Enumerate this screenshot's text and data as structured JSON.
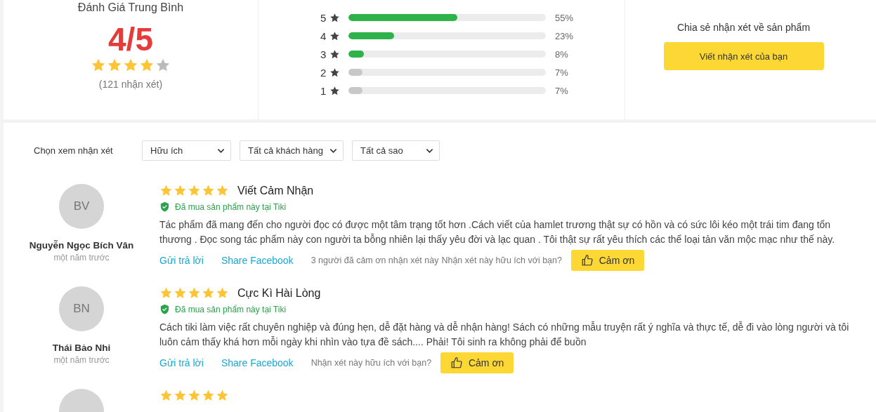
{
  "summary": {
    "title": "Đánh Giá Trung Bình",
    "score": "4/5",
    "stars": 4,
    "count": "(121 nhận xét)"
  },
  "bars": [
    {
      "label": "5",
      "level": 0.55,
      "percent": "55%",
      "color": "#2db34a"
    },
    {
      "label": "4",
      "level": 0.23,
      "percent": "23%",
      "color": "#2db34a"
    },
    {
      "label": "3",
      "level": 0.08,
      "percent": "8%",
      "color": "#2db34a"
    },
    {
      "label": "2",
      "level": 0.07,
      "percent": "7%",
      "color": "#c8c8c8"
    },
    {
      "label": "1",
      "level": 0.07,
      "percent": "7%",
      "color": "#c8c8c8"
    }
  ],
  "share": {
    "prompt": "Chia sẻ nhận xét về sản phẩm",
    "button": "Viết nhận xét của bạn"
  },
  "filters": {
    "label": "Chọn xem nhận xét",
    "dropdowns": [
      {
        "value": "Hữu ích"
      },
      {
        "value": "Tất cả khách hàng"
      },
      {
        "value": "Tất cả sao"
      }
    ]
  },
  "reviews": [
    {
      "initials": "BV",
      "name": "Nguyễn Ngọc Bích Vân",
      "time": "một năm trước",
      "stars": 5,
      "title": "Viết Cảm Nhận",
      "verified": "Đã mua sản phẩm này tại Tiki",
      "body": "Tác phẩm đã mang đến cho người đọc có được một tâm trạng tốt hơn .Cách viết của hamlet trương thật sự có hồn và có sức lôi kéo một trái tim đang tổn thương . Đọc song tác phẩm này con người ta bỗng nhiên lại thấy yêu đời và lạc quan . Tôi thật sự rất yêu thích các thể loại tản văn mộc mạc như thế này.",
      "reply": "Gửi trả lời",
      "share": "Share Facebook",
      "thanks_count": "3 người đã cảm ơn nhận xét này",
      "helpful": "Nhận xét này hữu ích với bạn?",
      "thanks_button": "Cảm ơn"
    },
    {
      "initials": "BN",
      "name": "Thái Bảo Nhi",
      "time": "một năm trước",
      "stars": 5,
      "title": "Cực Kì Hài Lòng",
      "verified": "Đã mua sản phẩm này tại Tiki",
      "body": "Cách tiki làm việc rất chuyên nghiệp và đúng hẹn, dễ đặt hàng và dễ nhận hàng! Sách có những mẫu truyện rất ý nghĩa và thực tế, dễ đi vào lòng người và tôi luôn cảm thấy khá hơn mỗi ngày khi nhìn vào tựa đề sách.... Phải! Tôi sinh ra không phải để buồn",
      "reply": "Gửi trả lời",
      "share": "Share Facebook",
      "helpful": "Nhận xét này hữu ích với bạn?",
      "thanks_button": "Cảm ơn"
    },
    {
      "stars": 5
    }
  ]
}
